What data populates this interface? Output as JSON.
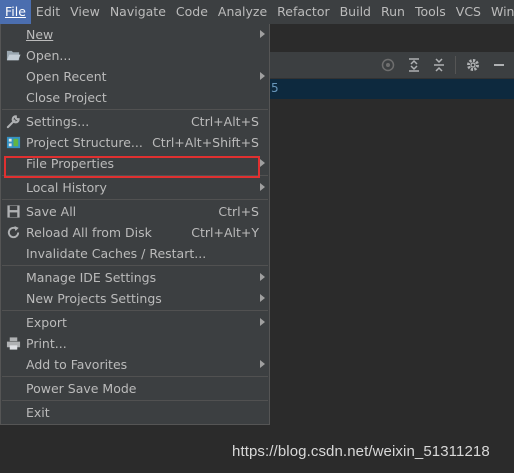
{
  "menubar": {
    "items": [
      "File",
      "Edit",
      "View",
      "Navigate",
      "Code",
      "Analyze",
      "Refactor",
      "Build",
      "Run",
      "Tools",
      "VCS",
      "Win"
    ]
  },
  "file_menu": {
    "items": [
      {
        "label": "New",
        "shortcut": "",
        "submenu": true,
        "icon": ""
      },
      {
        "label": "Open...",
        "shortcut": "",
        "submenu": false,
        "icon": "folder-icon"
      },
      {
        "label": "Open Recent",
        "shortcut": "",
        "submenu": true,
        "icon": ""
      },
      {
        "label": "Close Project",
        "shortcut": "",
        "submenu": false,
        "icon": ""
      },
      {
        "label": "Settings...",
        "shortcut": "Ctrl+Alt+S",
        "submenu": false,
        "icon": "wrench-icon"
      },
      {
        "label": "Project Structure...",
        "shortcut": "Ctrl+Alt+Shift+S",
        "submenu": false,
        "icon": "project-structure-icon"
      },
      {
        "label": "File Properties",
        "shortcut": "",
        "submenu": true,
        "icon": ""
      },
      {
        "label": "Local History",
        "shortcut": "",
        "submenu": true,
        "icon": ""
      },
      {
        "label": "Save All",
        "shortcut": "Ctrl+S",
        "submenu": false,
        "icon": "save-icon"
      },
      {
        "label": "Reload All from Disk",
        "shortcut": "Ctrl+Alt+Y",
        "submenu": false,
        "icon": "reload-icon"
      },
      {
        "label": "Invalidate Caches / Restart...",
        "shortcut": "",
        "submenu": false,
        "icon": ""
      },
      {
        "label": "Manage IDE Settings",
        "shortcut": "",
        "submenu": true,
        "icon": ""
      },
      {
        "label": "New Projects Settings",
        "shortcut": "",
        "submenu": true,
        "icon": ""
      },
      {
        "label": "Export",
        "shortcut": "",
        "submenu": true,
        "icon": ""
      },
      {
        "label": "Print...",
        "shortcut": "",
        "submenu": false,
        "icon": "print-icon"
      },
      {
        "label": "Add to Favorites",
        "shortcut": "",
        "submenu": true,
        "icon": ""
      },
      {
        "label": "Power Save Mode",
        "shortcut": "",
        "submenu": false,
        "icon": ""
      },
      {
        "label": "Exit",
        "shortcut": "",
        "submenu": false,
        "icon": ""
      }
    ],
    "highlighted_item": "Project Structure..."
  },
  "editor": {
    "strip_text": "5"
  },
  "watermark": "https://blog.csdn.net/weixin_51311218",
  "colors": {
    "menubar_bg": "#3c3f41",
    "active_menu": "#4b6eaf",
    "highlight_box": "#e03030",
    "editor_bg": "#2b2b2b"
  }
}
